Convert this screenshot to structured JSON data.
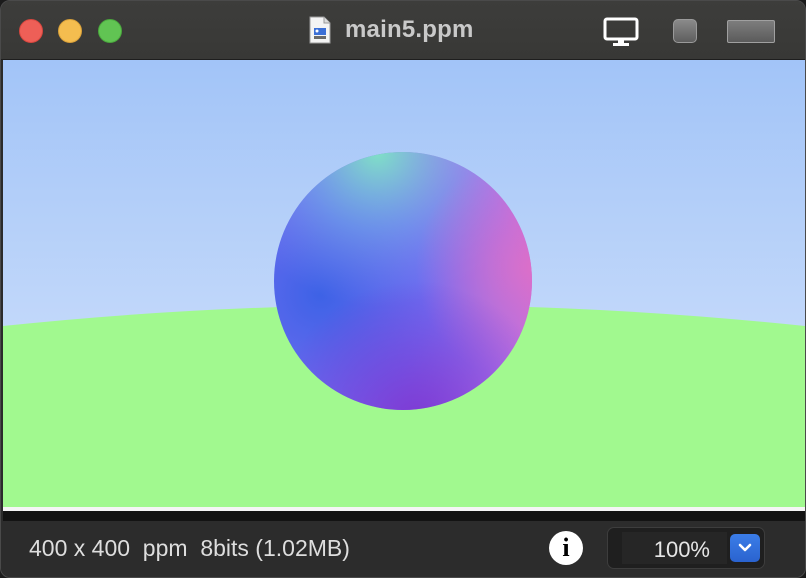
{
  "window": {
    "title": "main5.ppm"
  },
  "status": {
    "info_text": "400 x 400  ppm  8bits (1.02MB)",
    "zoom_value": "100%"
  },
  "icons": {
    "file": "document-icon",
    "monitor": "monitor-icon",
    "info": "info-icon",
    "dropdown": "chevron-down-icon"
  },
  "colors": {
    "close": "#ee5f57",
    "minimize": "#f4bd4f",
    "zoom": "#61c453",
    "sky_top": "#a2c4f8",
    "sky_bottom": "#d2e2fb",
    "ground": "#a1f98f",
    "sphere_left": "#3d5ce6",
    "sphere_right": "#d66bd6",
    "sphere_top": "#7fe0c8",
    "accent": "#2f6fdc"
  }
}
